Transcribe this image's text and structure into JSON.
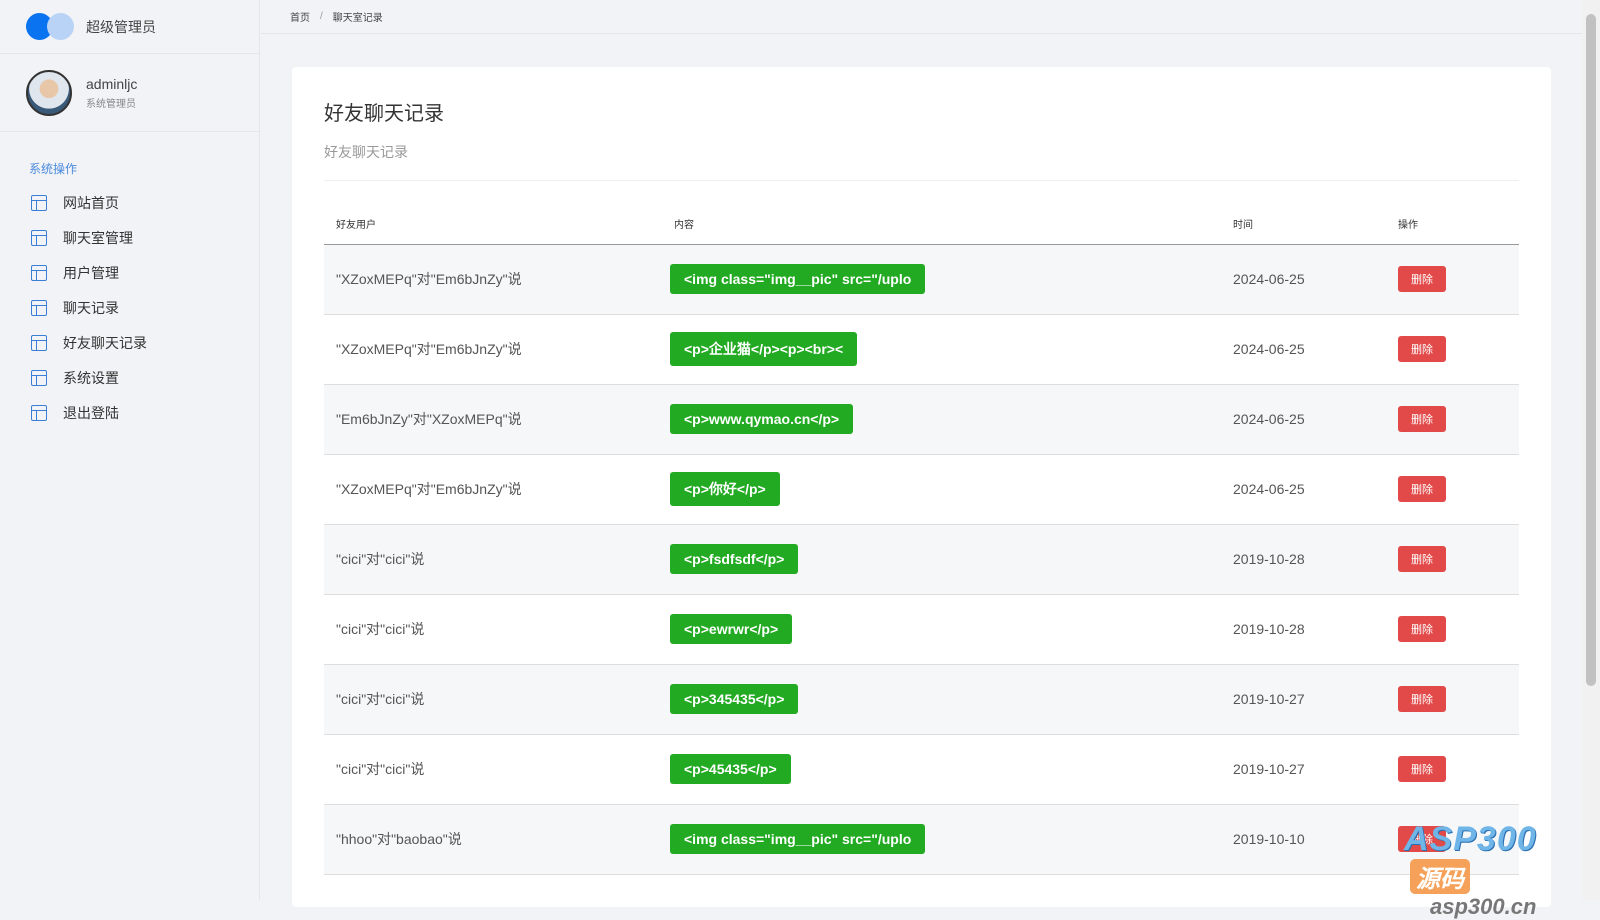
{
  "sidebar": {
    "brand": "超级管理员",
    "user": {
      "name": "adminljc",
      "role": "系统管理员"
    },
    "section": "系统操作",
    "items": [
      {
        "label": "网站首页"
      },
      {
        "label": "聊天室管理"
      },
      {
        "label": "用户管理"
      },
      {
        "label": "聊天记录"
      },
      {
        "label": "好友聊天记录"
      },
      {
        "label": "系统设置"
      },
      {
        "label": "退出登陆"
      }
    ]
  },
  "breadcrumb": {
    "home": "首页",
    "sep": "/",
    "current": "聊天室记录"
  },
  "main": {
    "title": "好友聊天记录",
    "subtitle": "好友聊天记录",
    "columns": [
      "好友用户",
      "内容",
      "时间",
      "操作"
    ],
    "rows": [
      {
        "user": "\"XZoxMEPq\"对\"Em6bJnZy\"说",
        "content": "<img class=\"img__pic\" src=\"/uplo",
        "time": "2024-06-25",
        "action": "删除"
      },
      {
        "user": "\"XZoxMEPq\"对\"Em6bJnZy\"说",
        "content": "<p>企业猫</p><p><br><",
        "time": "2024-06-25",
        "action": "删除"
      },
      {
        "user": "\"Em6bJnZy\"对\"XZoxMEPq\"说",
        "content": "<p>www.qymao.cn</p>",
        "time": "2024-06-25",
        "action": "删除"
      },
      {
        "user": "\"XZoxMEPq\"对\"Em6bJnZy\"说",
        "content": "<p>你好</p>",
        "time": "2024-06-25",
        "action": "删除"
      },
      {
        "user": "\"cici\"对\"cici\"说",
        "content": "<p>fsdfsdf</p>",
        "time": "2019-10-28",
        "action": "删除"
      },
      {
        "user": "\"cici\"对\"cici\"说",
        "content": "<p>ewrwr</p>",
        "time": "2019-10-28",
        "action": "删除"
      },
      {
        "user": "\"cici\"对\"cici\"说",
        "content": "<p>345435</p>",
        "time": "2019-10-27",
        "action": "删除"
      },
      {
        "user": "\"cici\"对\"cici\"说",
        "content": "<p>45435</p>",
        "time": "2019-10-27",
        "action": "删除"
      },
      {
        "user": "\"hhoo\"对\"baobao\"说",
        "content": "<img class=\"img__pic\" src=\"/uplo",
        "time": "2019-10-10",
        "action": "删除"
      }
    ]
  },
  "watermark": {
    "brand": "ASP300",
    "tag": "源码",
    "site": "asp300.cn"
  },
  "colors": {
    "accent": "#0a74f0",
    "content_badge": "#22aa22",
    "delete": "#e24a4a"
  }
}
